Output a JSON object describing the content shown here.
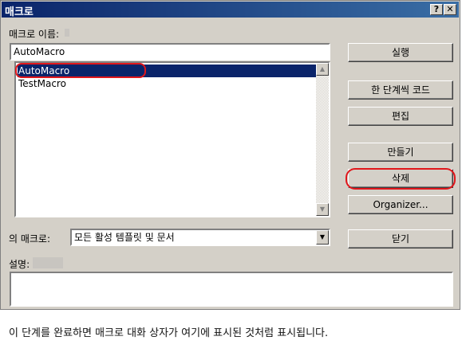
{
  "window": {
    "title": "매크로",
    "help_label": "?",
    "close_label": "✕"
  },
  "macro_name": {
    "label": "매크로 이름:",
    "value": "AutoMacro"
  },
  "macro_list": {
    "items": [
      "AutoMacro",
      "TestMacro"
    ],
    "selected": "AutoMacro"
  },
  "buttons": {
    "run": "실행",
    "step": "한 단계씩 코드",
    "edit": "편집",
    "create": "만들기",
    "delete": "삭제",
    "organizer": "Organizer...",
    "close": "닫기"
  },
  "macros_in": {
    "label": "의 매크로:",
    "value": "모든 활성 템플릿 및 문서"
  },
  "description": {
    "label": "설명:"
  },
  "caption": "이 단계를 완료하면 매크로 대화 상자가 여기에 표시된 것처럼 표시됩니다.",
  "colors": {
    "title_bar": "#0a246a",
    "selection": "#0a246a",
    "annotation": "#e0161b",
    "face": "#d4d0c8"
  }
}
